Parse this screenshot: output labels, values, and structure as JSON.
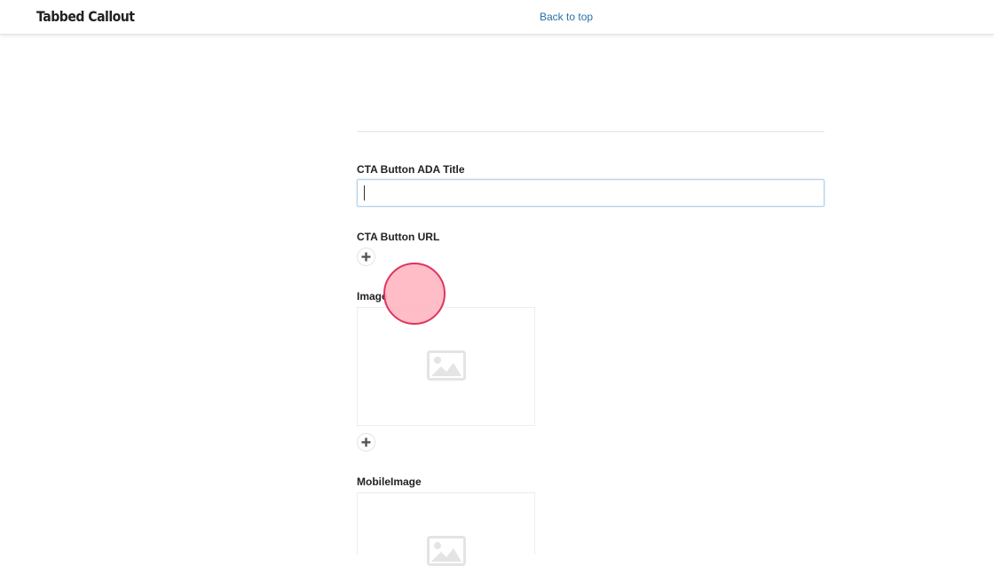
{
  "header": {
    "title": "Tabbed Callout",
    "back_link": "Back to top"
  },
  "form": {
    "cta_ada_title": {
      "label": "CTA Button ADA Title",
      "value": "",
      "placeholder": ""
    },
    "cta_url": {
      "label": "CTA Button URL",
      "add_icon": "plus-icon"
    },
    "image": {
      "label": "Image",
      "placeholder_icon": "image-placeholder-icon",
      "add_icon": "plus-icon"
    },
    "mobile_image": {
      "label": "MobileImage",
      "placeholder_icon": "image-placeholder-icon"
    }
  },
  "colors": {
    "link": "#2a6fa8",
    "input_border": "#b7d0e6",
    "click_indicator_fill": "#ffb6c1",
    "click_indicator_stroke": "#e0335f"
  }
}
